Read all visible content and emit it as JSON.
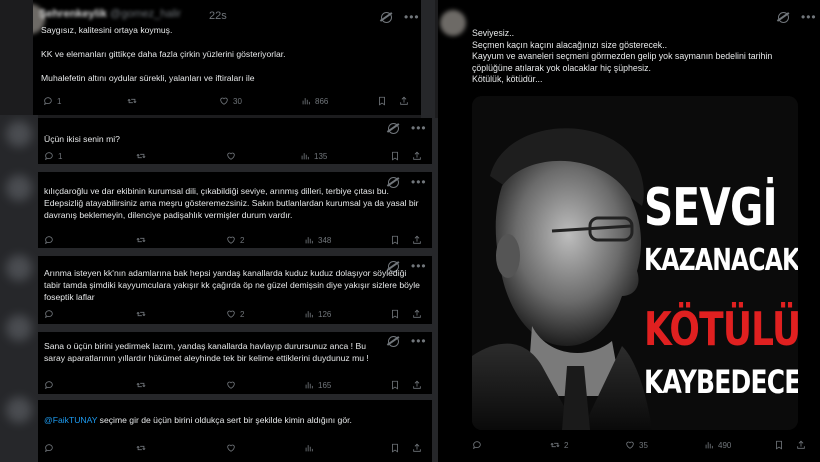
{
  "tweets": [
    {
      "time": "22s",
      "text": "Saygısız, kalitesini ortaya koymuş.\n\nKK ve elemanları gittikçe daha fazla çirkin yüzlerini gösteriyorlar.\n\nMuhalefetin altını oydular sürekli, yalanları ve iftiraları ile",
      "replies": "1",
      "reposts": "",
      "likes": "30",
      "views": "866"
    },
    {
      "text": "Üçün ikisi senin mi?",
      "replies": "1",
      "reposts": "",
      "likes": "",
      "views": "135"
    },
    {
      "text": "kılıçdaroğlu ve dar ekibinin kurumsal dili, çıkabildiği seviye, arınmış dilleri, terbiye çıtası bu. Edepsizliğ atayabilirsiniz ama meşru gösteremezsiniz. Sakın butlanlardan kurumsal ya da yasal bir davranış beklemeyin, dilenciye padişahlık vermişler durum vardır.",
      "replies": "",
      "reposts": "",
      "likes": "2",
      "views": "348"
    },
    {
      "text": "Arınma isteyen kk'nın adamlarına bak  hepsi yandaş kanallarda kuduz kuduz dolaşıyor söylediği tabir tamda şimdiki kayyumculara yakışır kk çağırda öp ne güzel demişsin diye yakışır sizlere böyle foseptik laflar",
      "replies": "",
      "reposts": "",
      "likes": "2",
      "views": "126"
    },
    {
      "text": "Sana o üçün birini yedirmek lazım, yandaş kanallarda havlayıp durursunuz anca ! Bu saray aparatlarının yıllardır hükümet aleyhinde tek bir kelime ettiklerini duydunuz mu !",
      "replies": "",
      "reposts": "",
      "likes": "",
      "views": "165"
    },
    {
      "mention": "@FaikTUNAY",
      "text": " seçime gir de üçün birini oldukça sert bir şekilde kimin aldığını gör.",
      "replies": "",
      "reposts": "",
      "likes": "",
      "views": ""
    }
  ],
  "main_tweet": {
    "text": "Seviyesiz..\nSeçmen kaçın kaçını alacağınızı size gösterecek..\nKayyum ve avaneleri seçmeni görmezden gelip yok saymanın bedelini tarihin çöplüğüne atılarak yok olacaklar hiç şüphesiz.\nKötülük, kötüdür...",
    "poster": {
      "line1": "SEVGİ",
      "line2": "KAZANACAK",
      "line3": "KÖTÜLÜK",
      "line4": "KAYBEDECEK!"
    },
    "replies": "",
    "reposts": "2",
    "likes": "35",
    "views": "490"
  },
  "colors": {
    "background": "#000000",
    "text": "#e7e9ea",
    "muted": "#71767b",
    "link": "#1d9bf0",
    "poster_red": "#e02020"
  },
  "icons": [
    "reply-icon",
    "repost-icon",
    "like-icon",
    "views-icon",
    "bookmark-icon",
    "share-icon",
    "grok-icon",
    "more-icon"
  ]
}
